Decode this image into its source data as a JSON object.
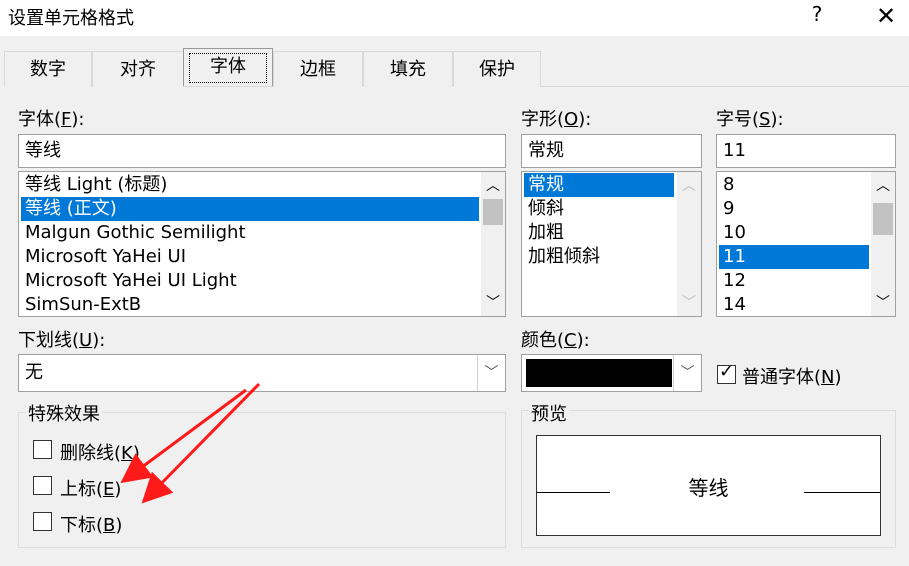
{
  "window": {
    "title": "设置单元格格式",
    "help": "?",
    "close": "✕"
  },
  "tabs": [
    {
      "label": "数字"
    },
    {
      "label": "对齐"
    },
    {
      "label": "字体"
    },
    {
      "label": "边框"
    },
    {
      "label": "填充"
    },
    {
      "label": "保护"
    }
  ],
  "font": {
    "label": "字体(",
    "key": "F",
    "label_end": "):",
    "value": "等线",
    "items": [
      "等线 Light (标题)",
      "等线 (正文)",
      "Malgun Gothic Semilight",
      "Microsoft YaHei UI",
      "Microsoft YaHei UI Light",
      "SimSun-ExtB"
    ],
    "selected_index": 1
  },
  "style": {
    "label": "字形(",
    "key": "O",
    "label_end": "):",
    "value": "常规",
    "items": [
      "常规",
      "倾斜",
      "加粗",
      "加粗倾斜"
    ],
    "selected_index": 0
  },
  "size": {
    "label": "字号(",
    "key": "S",
    "label_end": "):",
    "value": "11",
    "items": [
      "8",
      "9",
      "10",
      "11",
      "12",
      "14"
    ],
    "selected_index": 3
  },
  "underline": {
    "label": "下划线(",
    "key": "U",
    "label_end": "):",
    "value": "无"
  },
  "color": {
    "label": "颜色(",
    "key": "C",
    "label_end": "):",
    "value_color": "#000000"
  },
  "normal_font": {
    "label": "普通字体(",
    "key": "N",
    "label_end": ")",
    "checked": true
  },
  "effects": {
    "title": "特殊效果",
    "strikethrough": {
      "label": "删除线(",
      "key": "K",
      "label_end": ")"
    },
    "superscript": {
      "label": "上标(",
      "key": "E",
      "label_end": ")"
    },
    "subscript": {
      "label": "下标(",
      "key": "B",
      "label_end": ")"
    }
  },
  "preview": {
    "title": "预览",
    "text": "等线"
  },
  "colors": {
    "selection": "#0078d7",
    "annotation_arrow": "#ff1a1a"
  }
}
